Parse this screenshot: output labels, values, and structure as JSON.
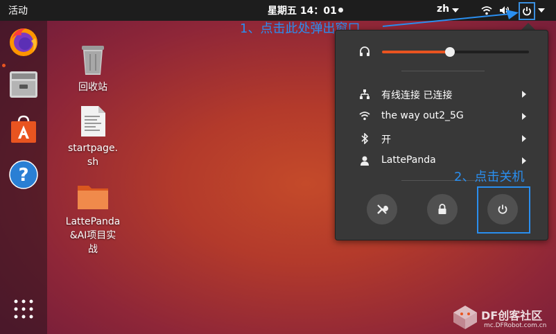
{
  "topbar": {
    "activities": "活动",
    "clock": "星期五 14：01",
    "input_method": "zh"
  },
  "desktop": {
    "icons": [
      {
        "label": "回收站"
      },
      {
        "label": "startpage.\nsh"
      },
      {
        "label": "LattePanda\n&AI项目实\n战"
      }
    ]
  },
  "annotations": {
    "step1": "1、点击此处弹出窗口",
    "step2": "2、点击关机"
  },
  "system_menu": {
    "volume_percent": 46,
    "items": [
      {
        "label": "有线连接 已连接",
        "icon": "wired-network-icon"
      },
      {
        "label": "the way out2_5G",
        "icon": "wifi-icon"
      },
      {
        "label": "开",
        "icon": "bluetooth-icon"
      },
      {
        "label": "LattePanda",
        "icon": "user-icon"
      }
    ],
    "buttons": [
      "settings-icon",
      "lock-icon",
      "power-icon"
    ]
  },
  "watermark": {
    "title": "DF创客社区",
    "url": "mc.DFRobot.com.cn"
  },
  "colors": {
    "accent": "#e95420",
    "annotation": "#2a8ff0",
    "menu_bg": "#383838",
    "topbar_bg": "#1d1d1d"
  }
}
